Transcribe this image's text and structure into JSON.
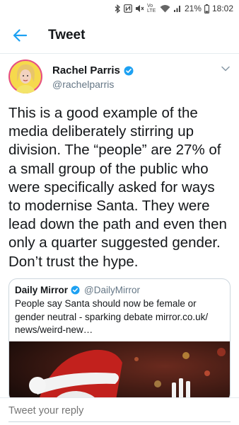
{
  "status_bar": {
    "battery_percent": "21%",
    "time": "18:02",
    "network_label": "Vo LTE",
    "icons": [
      "bluetooth-icon",
      "nfc-icon",
      "mute-icon",
      "volte-icon",
      "wifi-icon",
      "signal-icon",
      "battery-icon"
    ]
  },
  "header": {
    "title": "Tweet",
    "back_icon": "arrow-left-icon"
  },
  "tweet": {
    "author_name": "Rachel Parris",
    "author_handle": "@rachelparris",
    "verified": true,
    "text": "This is a good example of the\nmedia deliberately stirring up\ndivision. The “people” are 27% of\na small group of the public who\nwere specifically asked for ways\nto modernise Santa. They were\nlead down the path and even then\nonly a quarter suggested gender.\nDon’t trust the hype."
  },
  "quoted_tweet": {
    "author_name": "Daily Mirror",
    "author_handle": "@DailyMirror",
    "verified": true,
    "text": "People say Santa should now be female or\ngender neutral - sparking debate mirror.co.uk/\nnews/weird-new…"
  },
  "reply": {
    "placeholder": "Tweet your reply"
  },
  "colors": {
    "accent": "#1da1f2",
    "text": "#14171a",
    "secondary": "#657786",
    "border": "#ccd6dd"
  }
}
